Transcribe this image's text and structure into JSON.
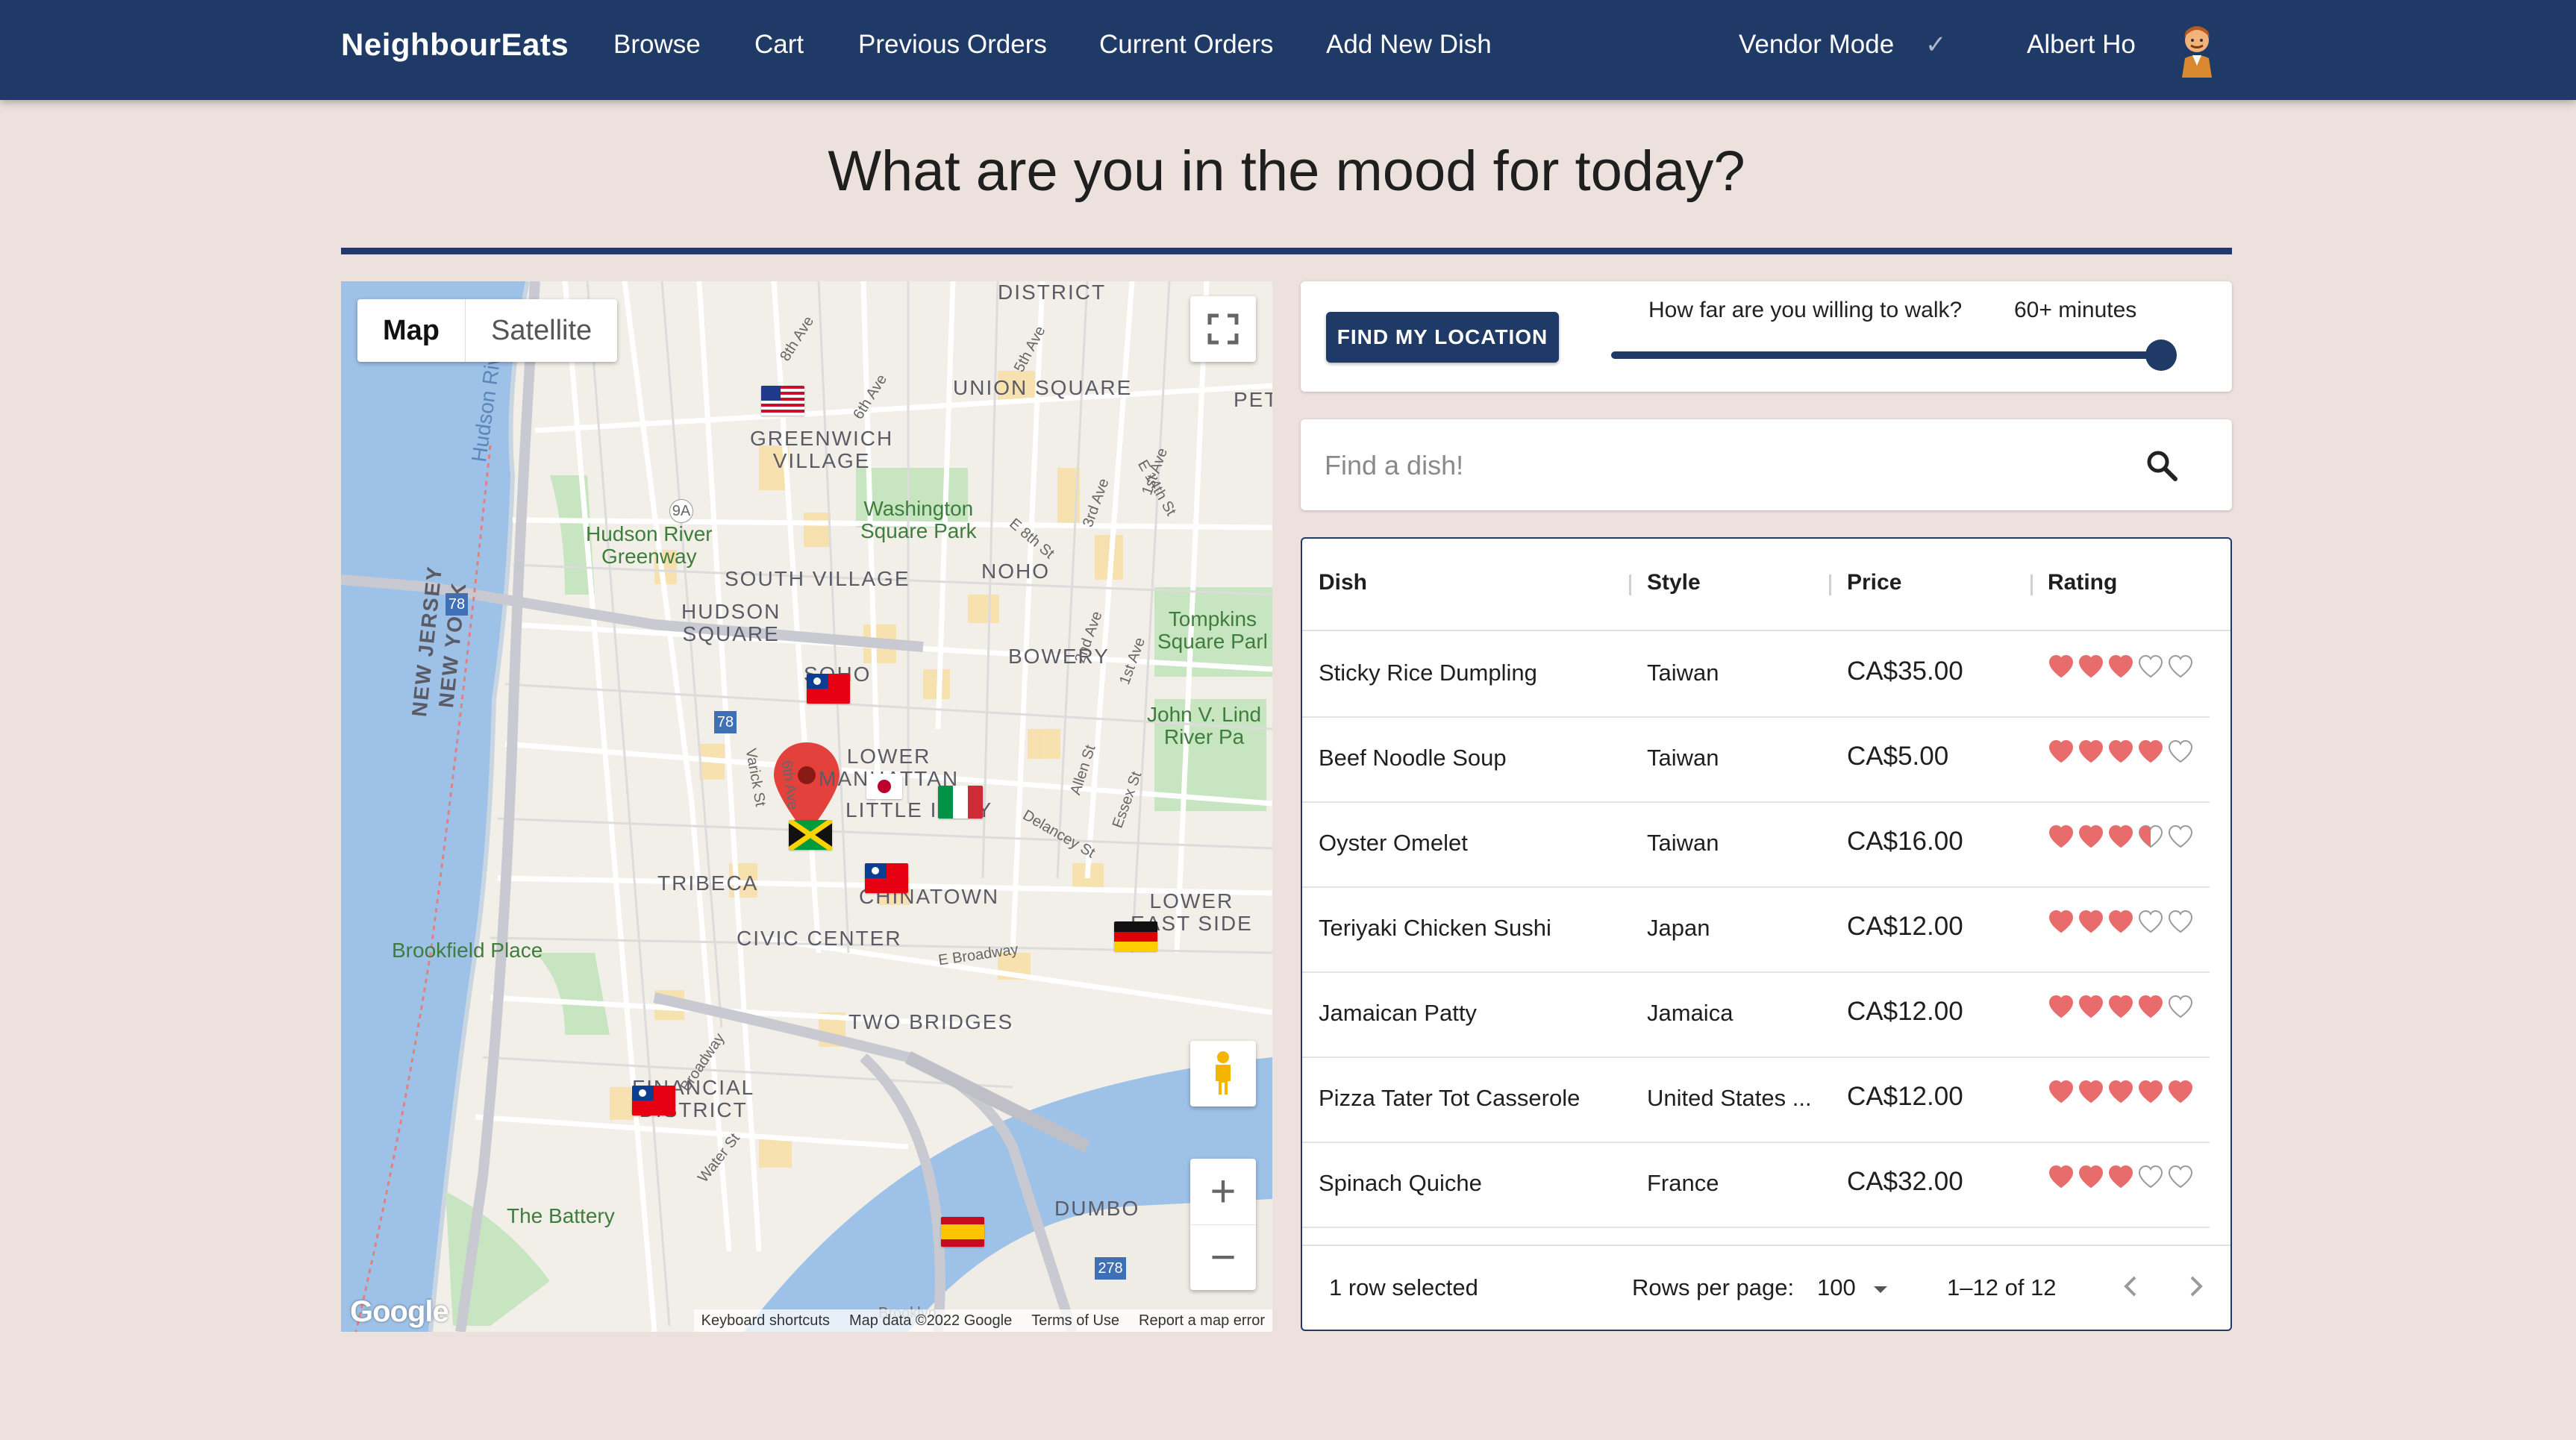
{
  "nav": {
    "brand": "NeighbourEats",
    "links": [
      "Browse",
      "Cart",
      "Previous Orders",
      "Current Orders",
      "Add New Dish"
    ],
    "vendor_mode": "Vendor Mode",
    "vendor_check": "✓",
    "user_name": "Albert Ho"
  },
  "heading": "What are you in the mood for today?",
  "map": {
    "type_buttons": [
      "Map",
      "Satellite"
    ],
    "active_type": "Map",
    "zoom_in": "+",
    "zoom_out": "−",
    "google_logo": "Google",
    "footer": [
      "Keyboard shortcuts",
      "Map data ©2022 Google",
      "Terms of Use",
      "Report a map error"
    ],
    "labels": {
      "district": "DISTRICT",
      "union_square": "UNION SQUARE",
      "greenwich": "GREENWICH\nVILLAGE",
      "pet": "PET",
      "washington_park": "Washington\nSquare Park",
      "hudson_greenway": "Hudson River\nGreenway",
      "south_village": "SOUTH VILLAGE",
      "noho": "NOHO",
      "hudson_square": "HUDSON\nSQUARE",
      "soho": "SOHO",
      "bowery": "BOWERY",
      "tompkins": "Tompkins\nSquare Parl",
      "lower_manhattan": "LOWER\nMANHATTAN",
      "little_italy": "LITTLE ITALY",
      "john_lind": "John V. Lind\nRiver Pa",
      "new_jersey": "NEW JERSEY",
      "new_york": "NEW YORK",
      "tribeca": "TRIBECA",
      "chinatown": "CHINATOWN",
      "lower_east_side": "LOWER\nEAST SIDE",
      "brookfield": "Brookfield Place",
      "civic_center": "CIVIC CENTER",
      "two_bridges": "TWO BRIDGES",
      "financial": "FINANCIAL\nDISTRICT",
      "battery": "The Battery",
      "dumbo": "DUMBO",
      "brooklyn": "Brooklyn",
      "hudson_river": "Hudson River",
      "e_broadway": "E Broadway",
      "broadway": "Broadway",
      "water_st": "Water St",
      "delancey": "Delancey St",
      "essex": "Essex St",
      "allen": "Allen St",
      "varick": "Varick St",
      "sixth_ave": "6th Ave",
      "eighth_ave": "8th Ave",
      "fifth_ave": "5th Ave",
      "third_ave": "3rd Ave",
      "second_ave": "2nd Ave",
      "first_ave": "1st Ave",
      "e14": "E 14th St",
      "e8": "E 8th St",
      "r9a": "9A",
      "r78a": "78",
      "r78b": "78",
      "r278": "278"
    }
  },
  "location": {
    "button": "FIND MY LOCATION",
    "walk_label": "How far are you willing to walk?",
    "walk_value": "60+ minutes",
    "walk_level_pct": 100
  },
  "search": {
    "placeholder": "Find a dish!"
  },
  "table": {
    "columns": [
      "Dish",
      "Style",
      "Price",
      "Rating"
    ],
    "rows": [
      {
        "dish": "Sticky Rice Dumpling",
        "style": "Taiwan",
        "price": "CA$35.00",
        "rating": 3
      },
      {
        "dish": "Beef Noodle Soup",
        "style": "Taiwan",
        "price": "CA$5.00",
        "rating": 4
      },
      {
        "dish": "Oyster Omelet",
        "style": "Taiwan",
        "price": "CA$16.00",
        "rating": 3.5
      },
      {
        "dish": "Teriyaki Chicken Sushi",
        "style": "Japan",
        "price": "CA$12.00",
        "rating": 3
      },
      {
        "dish": "Jamaican Patty",
        "style": "Jamaica",
        "price": "CA$12.00",
        "rating": 4
      },
      {
        "dish": "Pizza Tater Tot Casserole",
        "style": "United States ...",
        "price": "CA$12.00",
        "rating": 5
      },
      {
        "dish": "Spinach Quiche",
        "style": "France",
        "price": "CA$32.00",
        "rating": 3
      }
    ],
    "footer": {
      "selected": "1 row selected",
      "rows_per_page_label": "Rows per page:",
      "rows_per_page": "100",
      "range": "1–12 of 12"
    }
  },
  "colors": {
    "nav": "#1f3a66",
    "background": "#ece1dd",
    "heart": "#e96c6c"
  }
}
